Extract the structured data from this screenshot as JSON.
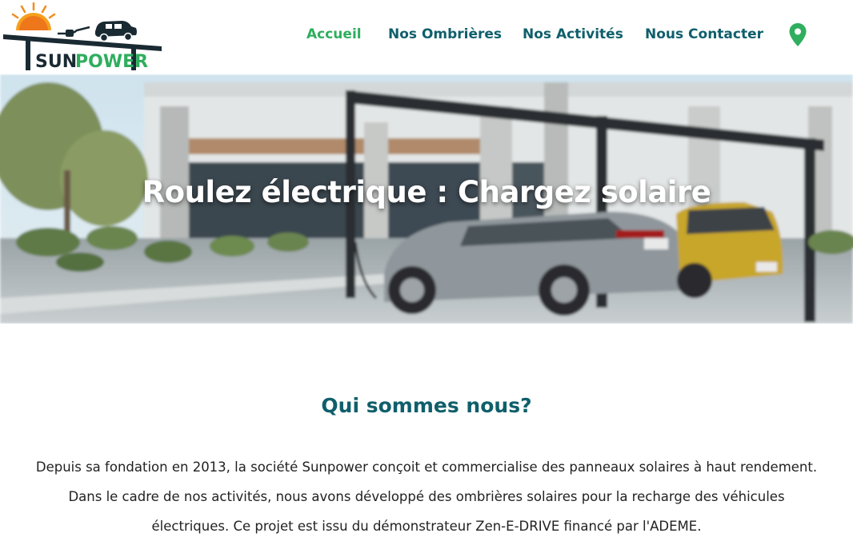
{
  "header": {
    "logo_text": "SUNPOWER",
    "nav": [
      {
        "label": "Accueil",
        "active": true
      },
      {
        "label": "Nos Ombrières",
        "active": false
      },
      {
        "label": "Nos Activités",
        "active": false
      },
      {
        "label": "Nous Contacter",
        "active": false
      }
    ],
    "location_icon": "map-pin-icon"
  },
  "hero": {
    "title": "Roulez électrique : Chargez solaire"
  },
  "about": {
    "title": "Qui sommes nous?",
    "text": "Depuis sa fondation en 2013, la société Sunpower conçoit et commercialise des panneaux solaires à haut rendement. Dans le cadre de nos activités, nous avons développé des ombrières solaires pour la recharge des véhicules électriques. Ce projet est issu du démonstrateur Zen-E-DRIVE financé par l'ADEME."
  },
  "colors": {
    "nav_text": "#0f5f6b",
    "nav_active": "#2fae5e",
    "accent_green": "#2fae5e",
    "logo_orange": "#f28c1e"
  }
}
